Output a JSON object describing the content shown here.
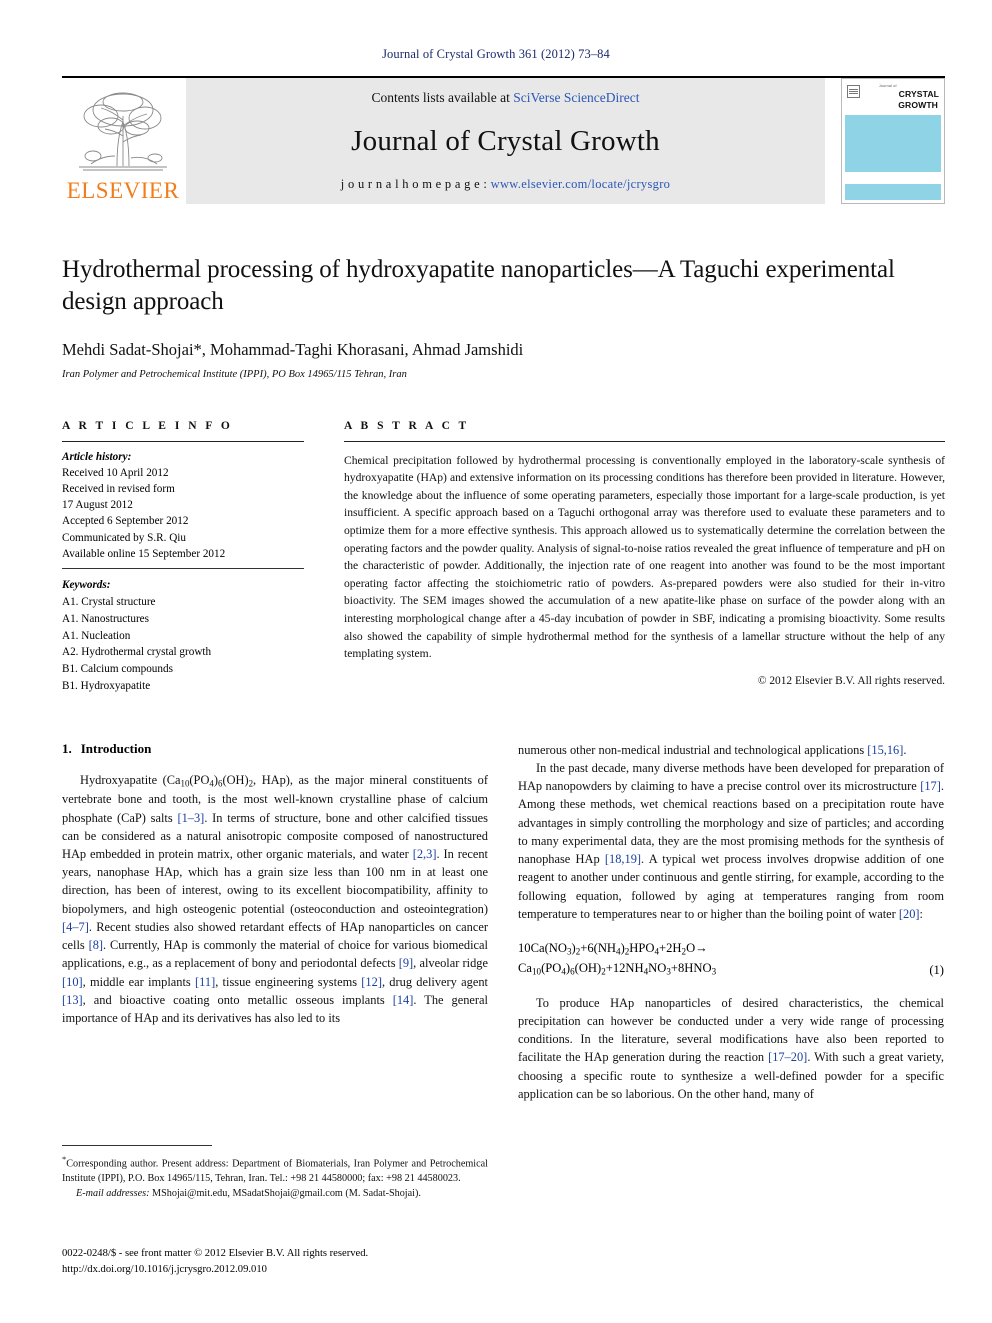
{
  "running_head": "Journal of Crystal Growth 361 (2012) 73–84",
  "masthead": {
    "publisher": "ELSEVIER",
    "contents_prefix": "Contents lists available at ",
    "contents_link": "SciVerse ScienceDirect",
    "journal_title": "Journal of Crystal Growth",
    "homepage_label": "j o u r n a l   h o m e p a g e :  ",
    "homepage_url": "www.elsevier.com/locate/jcrysgro",
    "cover": {
      "sub": "Journal of",
      "line1": "CRYSTAL",
      "line2": "GROWTH"
    },
    "colors": {
      "elsevier_orange": "#f07d1a",
      "link_blue": "#2b57b5",
      "cover_cyan": "#8ed3e6",
      "band_gray": "#e8e8e8"
    }
  },
  "article": {
    "title": "Hydrothermal processing of hydroxyapatite nanoparticles—A Taguchi experimental design approach",
    "authors": "Mehdi Sadat-Shojai*, Mohammad-Taghi Khorasani, Ahmad Jamshidi",
    "affiliation": "Iran Polymer and Petrochemical Institute (IPPI), PO Box 14965/115 Tehran, Iran"
  },
  "info": {
    "heading": "A R T I C L E   I N F O",
    "history_label": "Article history:",
    "history": [
      "Received 10 April 2012",
      "Received in revised form",
      "17 August 2012",
      "Accepted 6 September 2012",
      "Communicated by S.R. Qiu",
      "Available online 15 September 2012"
    ],
    "keywords_label": "Keywords:",
    "keywords": [
      "A1. Crystal structure",
      "A1. Nanostructures",
      "A1. Nucleation",
      "A2. Hydrothermal crystal growth",
      "B1. Calcium compounds",
      "B1. Hydroxyapatite"
    ]
  },
  "abstract": {
    "heading": "A B S T R A C T",
    "text": "Chemical precipitation followed by hydrothermal processing is conventionally employed in the laboratory-scale synthesis of hydroxyapatite (HAp) and extensive information on its processing conditions has therefore been provided in literature. However, the knowledge about the influence of some operating parameters, especially those important for a large-scale production, is yet insufficient. A specific approach based on a Taguchi orthogonal array was therefore used to evaluate these parameters and to optimize them for a more effective synthesis. This approach allowed us to systematically determine the correlation between the operating factors and the powder quality. Analysis of signal-to-noise ratios revealed the great influence of temperature and pH on the characteristic of powder. Additionally, the injection rate of one reagent into another was found to be the most important operating factor affecting the stoichiometric ratio of powders. As-prepared powders were also studied for their in-vitro bioactivity. The SEM images showed the accumulation of a new apatite-like phase on surface of the powder along with an interesting morphological change after a 45-day incubation of powder in SBF, indicating a promising bioactivity. Some results also showed the capability of simple hydrothermal method for the synthesis of a lamellar structure without the help of any templating system.",
    "copyright": "© 2012 Elsevier B.V. All rights reserved."
  },
  "introduction": {
    "number": "1.",
    "title": "Introduction",
    "left_paragraph_1_part1": "Hydroxyapatite (Ca",
    "left_paragraph_1": {
      "seg1": "Hydroxyapatite (Ca",
      "sub1": "10",
      "seg2": "(PO",
      "sub2": "4",
      "seg3": ")",
      "sub3": "6",
      "seg4": "(OH)",
      "sub4": "2",
      "seg5": ", HAp), as the major mineral constituents of vertebrate bone and tooth, is the most well-known crystalline phase of calcium phosphate (CaP) salts ",
      "cite1": "[1–3]",
      "seg6": ". In terms of structure, bone and other calcified tissues can be considered as a natural anisotropic composite composed of nanostructured HAp embedded in protein matrix, other organic materials, and water ",
      "cite2": "[2,3]",
      "seg7": ". In recent years, nanophase HAp, which has a grain size less than 100 nm in at least one direction, has been of interest, owing to its excellent biocompatibility, affinity to biopolymers, and high osteogenic potential (osteoconduction and osteointegration) ",
      "cite3": "[4–7]",
      "seg8": ". Recent studies also showed retardant effects of HAp nanoparticles on cancer cells ",
      "cite4": "[8]",
      "seg9": ". Currently, HAp is commonly the material of choice for various biomedical applications, e.g., as a replacement of bony and periodontal defects ",
      "cite5": "[9]",
      "seg10": ", alveolar ridge ",
      "cite6": "[10]",
      "seg11": ", middle ear implants ",
      "cite7": "[11]",
      "seg12": ", tissue engineering systems ",
      "cite8": "[12]",
      "seg13": ", drug delivery agent ",
      "cite9": "[13]",
      "seg14": ", and bioactive coating onto metallic osseous implants ",
      "cite10": "[14]",
      "seg15": ". The general importance of HAp and its derivatives has also led to its"
    },
    "right_paragraph_continuation": {
      "seg1": "numerous other non-medical industrial and technological applications ",
      "cite1": "[15,16]",
      "seg2": "."
    },
    "right_paragraph_2": {
      "seg1": "In the past decade, many diverse methods have been developed for preparation of HAp nanopowders by claiming to have a precise control over its microstructure ",
      "cite1": "[17]",
      "seg2": ". Among these methods, wet chemical reactions based on a precipitation route have advantages in simply controlling the morphology and size of particles; and according to many experimental data, they are the most promising methods for the synthesis of nanophase HAp ",
      "cite2": "[18,19]",
      "seg3": ". A typical wet process involves dropwise addition of one reagent to another under continuous and gentle stirring, for example, according to the following equation, followed by aging at temperatures ranging from room temperature to temperatures near to or higher than the boiling point of water ",
      "cite3": "[20]",
      "seg4": ":"
    },
    "right_paragraph_3": {
      "seg1": "To produce HAp nanoparticles of desired characteristics, the chemical precipitation can however be conducted under a very wide range of processing conditions. In the literature, several modifications have also been reported to facilitate the HAp generation during the reaction ",
      "cite1": "[17–20]",
      "seg2": ". With such a great variety, choosing a specific route to synthesize a well-defined powder for a specific application can be so laborious. On the other hand, many of"
    }
  },
  "equation": {
    "line1": "10Ca(NO3)2+6(NH4)2HPO4+2H2O→",
    "line2": "Ca10(PO4)6(OH)2+12NH4NO3+8HNO3",
    "number": "(1)"
  },
  "footnote": {
    "marker": "*",
    "text": "Corresponding author. Present address: Department of Biomaterials, Iran Polymer and Petrochemical Institute (IPPI), P.O. Box 14965/115, Tehran, Iran. Tel.: +98 21 44580000; fax: +98 21 44580023.",
    "email_label": "E-mail addresses:",
    "emails": "MShojai@mit.edu, MSadatShojai@gmail.com (M. Sadat-Shojai)."
  },
  "imprint": {
    "issn_line": "0022-0248/$ - see front matter © 2012 Elsevier B.V. All rights reserved.",
    "doi_line": "http://dx.doi.org/10.1016/j.jcrysgro.2012.09.010"
  }
}
